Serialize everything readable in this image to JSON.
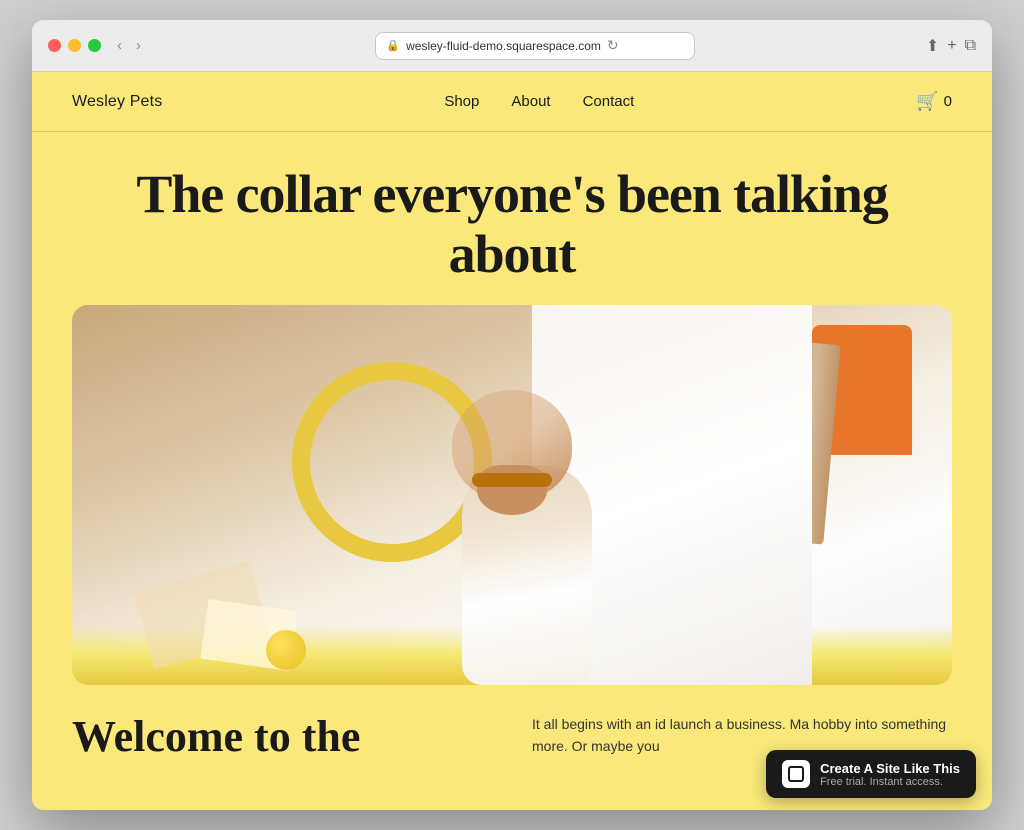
{
  "browser": {
    "url": "wesley-fluid-demo.squarespace.com",
    "reload_label": "↻",
    "back_label": "‹",
    "forward_label": "›",
    "window_controls": [
      "red",
      "yellow",
      "green"
    ],
    "share_label": "⬆",
    "new_tab_label": "+",
    "copy_label": "⧉",
    "grid_label": "⊞"
  },
  "nav": {
    "brand": "Wesley Pets",
    "links": [
      "Shop",
      "About",
      "Contact"
    ],
    "cart_count": "0"
  },
  "hero": {
    "title": "The collar everyone's been talking about"
  },
  "bottom": {
    "welcome_title": "Welcome to the",
    "body_text": "It all begins with an id launch a business. Ma hobby into something more. Or maybe you"
  },
  "squarespace_banner": {
    "main_text": "Create A Site Like This",
    "sub_text": "Free trial. Instant access."
  }
}
